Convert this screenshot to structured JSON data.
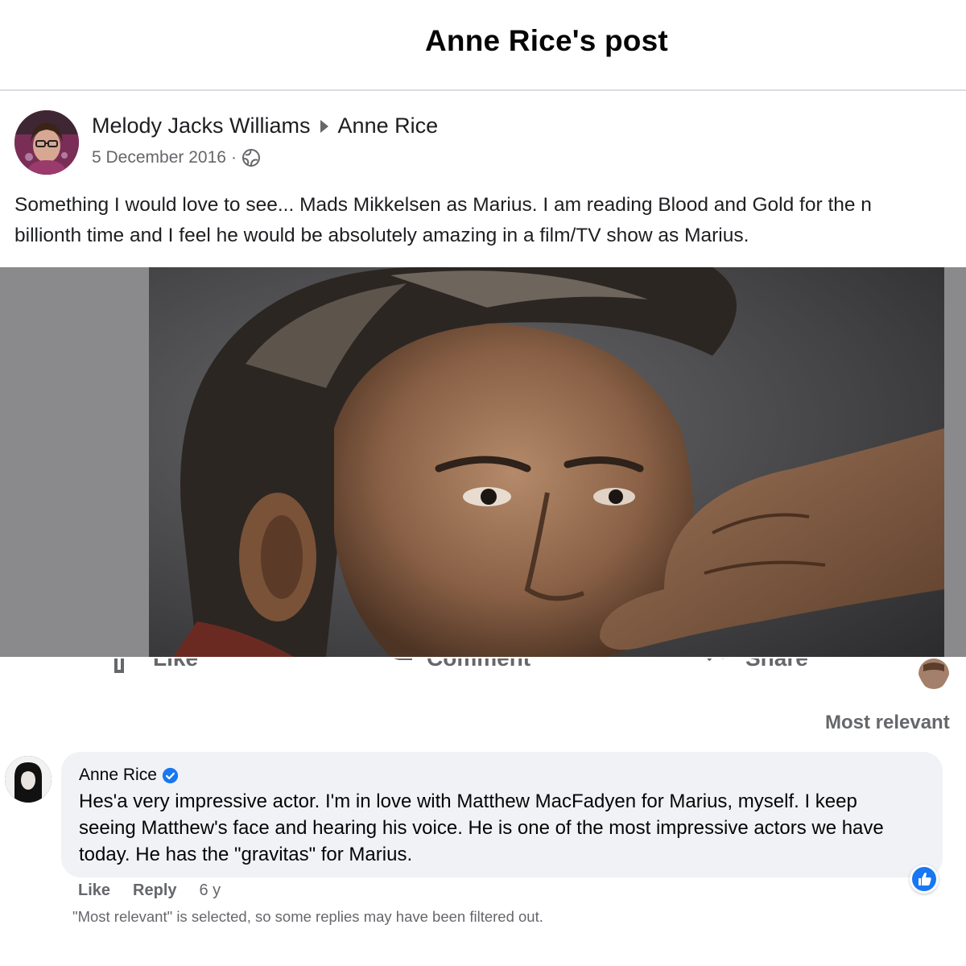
{
  "header": {
    "title": "Anne Rice's post"
  },
  "post": {
    "author": "Melody Jacks Williams",
    "target": "Anne Rice",
    "date": "5 December 2016",
    "separator": "·",
    "privacy_icon": "globe-icon",
    "text_lines": [
      "Something I would love to see... Mads Mikkelsen as Marius. I am reading Blood and Gold for the n",
      "billionth time and I feel he would be absolutely amazing in a film/TV show as Marius."
    ],
    "photo": "portrait-photo"
  },
  "actions": {
    "like": "Like",
    "comment": "Comment",
    "share": "Share"
  },
  "comments": {
    "sort_label": "Most relevant",
    "items": [
      {
        "author": "Anne Rice",
        "verified": true,
        "text_lines": [
          "Hes'a very impressive actor. I'm in love with Matthew MacFadyen for Marius, myself. I keep",
          "seeing Matthew's face and hearing his voice. He is one of the most impressive actors we have",
          "today. He has the \"gravitas\" for Marius."
        ],
        "like_label": "Like",
        "reply_label": "Reply",
        "time": "6 y",
        "reaction_icon": "thumbs-up-icon"
      }
    ],
    "filter_note": "\"Most relevant\" is selected, so some replies may have been filtered out."
  },
  "colors": {
    "accent": "#1877f2",
    "muted": "#65676b",
    "bubble": "#f0f2f5"
  }
}
